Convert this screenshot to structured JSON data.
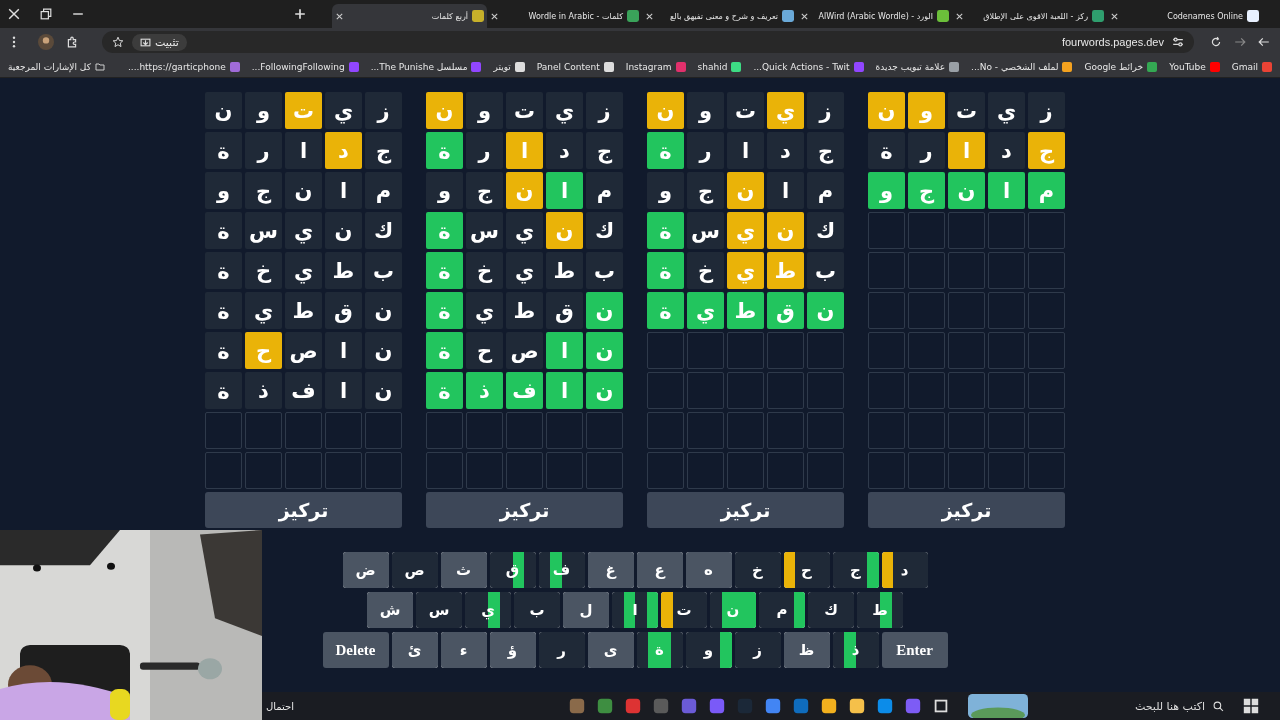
{
  "tabs": [
    {
      "title": "Codenames Online",
      "selected": false
    },
    {
      "title": "ركز - اللعبة الاقوى على الإطلاق",
      "selected": false
    },
    {
      "title": "الورد - AlWird (Arabic Wordle)",
      "selected": false
    },
    {
      "title": "تعريف و شرح و معنى تفيهق بالع",
      "selected": false
    },
    {
      "title": "كلمات - Wordle in Arabic",
      "selected": false
    },
    {
      "title": "أربع كلمات",
      "selected": true
    }
  ],
  "address_bar": {
    "pin_label": "تثبيت",
    "url": "fourwords.pages.dev"
  },
  "bookmarks": {
    "items": [
      "Gmail",
      "YouTube",
      "خرائط Google",
      "لملف الشخصي - No...",
      "علامة تبويب جديدة",
      "Quick Actions - Twit...",
      "shahid",
      "Instagram",
      "Panel Content",
      "تويتر",
      "مسلسل The Punishe...",
      "FollowingFollowing...",
      "https://garticphone...."
    ],
    "all_bookmarks": "كل الإشارات المرجعية"
  },
  "boards": [
    {
      "button": "تركيز",
      "guesses": [
        [
          {
            "letter": "ز",
            "kind": "absent"
          },
          {
            "letter": "ي",
            "kind": "absent"
          },
          {
            "letter": "ت",
            "kind": "absent"
          },
          {
            "letter": "و",
            "kind": "present"
          },
          {
            "letter": "ن",
            "kind": "present"
          }
        ],
        [
          {
            "letter": "ج",
            "kind": "present"
          },
          {
            "letter": "د",
            "kind": "absent"
          },
          {
            "letter": "ا",
            "kind": "present"
          },
          {
            "letter": "ر",
            "kind": "absent"
          },
          {
            "letter": "ة",
            "kind": "absent"
          }
        ],
        [
          {
            "letter": "م",
            "kind": "correct"
          },
          {
            "letter": "ا",
            "kind": "correct"
          },
          {
            "letter": "ن",
            "kind": "correct"
          },
          {
            "letter": "ج",
            "kind": "correct"
          },
          {
            "letter": "و",
            "kind": "correct"
          }
        ]
      ]
    },
    {
      "button": "تركيز",
      "guesses": [
        [
          {
            "letter": "ز",
            "kind": "absent"
          },
          {
            "letter": "ي",
            "kind": "present"
          },
          {
            "letter": "ت",
            "kind": "absent"
          },
          {
            "letter": "و",
            "kind": "absent"
          },
          {
            "letter": "ن",
            "kind": "present"
          }
        ],
        [
          {
            "letter": "ج",
            "kind": "absent"
          },
          {
            "letter": "د",
            "kind": "absent"
          },
          {
            "letter": "ا",
            "kind": "absent"
          },
          {
            "letter": "ر",
            "kind": "absent"
          },
          {
            "letter": "ة",
            "kind": "correct"
          }
        ],
        [
          {
            "letter": "م",
            "kind": "absent"
          },
          {
            "letter": "ا",
            "kind": "absent"
          },
          {
            "letter": "ن",
            "kind": "present"
          },
          {
            "letter": "ج",
            "kind": "absent"
          },
          {
            "letter": "و",
            "kind": "absent"
          }
        ],
        [
          {
            "letter": "ك",
            "kind": "absent"
          },
          {
            "letter": "ن",
            "kind": "present"
          },
          {
            "letter": "ي",
            "kind": "present"
          },
          {
            "letter": "س",
            "kind": "absent"
          },
          {
            "letter": "ة",
            "kind": "correct"
          }
        ],
        [
          {
            "letter": "ب",
            "kind": "absent"
          },
          {
            "letter": "ط",
            "kind": "present"
          },
          {
            "letter": "ي",
            "kind": "present"
          },
          {
            "letter": "خ",
            "kind": "absent"
          },
          {
            "letter": "ة",
            "kind": "correct"
          }
        ],
        [
          {
            "letter": "ن",
            "kind": "correct"
          },
          {
            "letter": "ق",
            "kind": "correct"
          },
          {
            "letter": "ط",
            "kind": "correct"
          },
          {
            "letter": "ي",
            "kind": "correct"
          },
          {
            "letter": "ة",
            "kind": "correct"
          }
        ]
      ]
    },
    {
      "button": "تركيز",
      "guesses": [
        [
          {
            "letter": "ز",
            "kind": "absent"
          },
          {
            "letter": "ي",
            "kind": "absent"
          },
          {
            "letter": "ت",
            "kind": "absent"
          },
          {
            "letter": "و",
            "kind": "absent"
          },
          {
            "letter": "ن",
            "kind": "present"
          }
        ],
        [
          {
            "letter": "ج",
            "kind": "absent"
          },
          {
            "letter": "د",
            "kind": "absent"
          },
          {
            "letter": "ا",
            "kind": "present"
          },
          {
            "letter": "ر",
            "kind": "absent"
          },
          {
            "letter": "ة",
            "kind": "correct"
          }
        ],
        [
          {
            "letter": "م",
            "kind": "absent"
          },
          {
            "letter": "ا",
            "kind": "correct"
          },
          {
            "letter": "ن",
            "kind": "present"
          },
          {
            "letter": "ج",
            "kind": "absent"
          },
          {
            "letter": "و",
            "kind": "absent"
          }
        ],
        [
          {
            "letter": "ك",
            "kind": "absent"
          },
          {
            "letter": "ن",
            "kind": "present"
          },
          {
            "letter": "ي",
            "kind": "absent"
          },
          {
            "letter": "س",
            "kind": "absent"
          },
          {
            "letter": "ة",
            "kind": "correct"
          }
        ],
        [
          {
            "letter": "ب",
            "kind": "absent"
          },
          {
            "letter": "ط",
            "kind": "absent"
          },
          {
            "letter": "ي",
            "kind": "absent"
          },
          {
            "letter": "خ",
            "kind": "absent"
          },
          {
            "letter": "ة",
            "kind": "correct"
          }
        ],
        [
          {
            "letter": "ن",
            "kind": "correct"
          },
          {
            "letter": "ق",
            "kind": "absent"
          },
          {
            "letter": "ط",
            "kind": "absent"
          },
          {
            "letter": "ي",
            "kind": "absent"
          },
          {
            "letter": "ة",
            "kind": "correct"
          }
        ],
        [
          {
            "letter": "ن",
            "kind": "correct"
          },
          {
            "letter": "ا",
            "kind": "correct"
          },
          {
            "letter": "ص",
            "kind": "absent"
          },
          {
            "letter": "ح",
            "kind": "absent"
          },
          {
            "letter": "ة",
            "kind": "correct"
          }
        ],
        [
          {
            "letter": "ن",
            "kind": "correct"
          },
          {
            "letter": "ا",
            "kind": "correct"
          },
          {
            "letter": "ف",
            "kind": "correct"
          },
          {
            "letter": "ذ",
            "kind": "correct"
          },
          {
            "letter": "ة",
            "kind": "correct"
          }
        ]
      ]
    },
    {
      "button": "تركيز",
      "guesses": [
        [
          {
            "letter": "ز",
            "kind": "absent"
          },
          {
            "letter": "ي",
            "kind": "absent"
          },
          {
            "letter": "ت",
            "kind": "present"
          },
          {
            "letter": "و",
            "kind": "absent"
          },
          {
            "letter": "ن",
            "kind": "absent"
          }
        ],
        [
          {
            "letter": "ج",
            "kind": "absent"
          },
          {
            "letter": "د",
            "kind": "present"
          },
          {
            "letter": "ا",
            "kind": "absent"
          },
          {
            "letter": "ر",
            "kind": "absent"
          },
          {
            "letter": "ة",
            "kind": "absent"
          }
        ],
        [
          {
            "letter": "م",
            "kind": "absent"
          },
          {
            "letter": "ا",
            "kind": "absent"
          },
          {
            "letter": "ن",
            "kind": "absent"
          },
          {
            "letter": "ج",
            "kind": "absent"
          },
          {
            "letter": "و",
            "kind": "absent"
          }
        ],
        [
          {
            "letter": "ك",
            "kind": "absent"
          },
          {
            "letter": "ن",
            "kind": "absent"
          },
          {
            "letter": "ي",
            "kind": "absent"
          },
          {
            "letter": "س",
            "kind": "absent"
          },
          {
            "letter": "ة",
            "kind": "absent"
          }
        ],
        [
          {
            "letter": "ب",
            "kind": "absent"
          },
          {
            "letter": "ط",
            "kind": "absent"
          },
          {
            "letter": "ي",
            "kind": "absent"
          },
          {
            "letter": "خ",
            "kind": "absent"
          },
          {
            "letter": "ة",
            "kind": "absent"
          }
        ],
        [
          {
            "letter": "ن",
            "kind": "absent"
          },
          {
            "letter": "ق",
            "kind": "absent"
          },
          {
            "letter": "ط",
            "kind": "absent"
          },
          {
            "letter": "ي",
            "kind": "absent"
          },
          {
            "letter": "ة",
            "kind": "absent"
          }
        ],
        [
          {
            "letter": "ن",
            "kind": "absent"
          },
          {
            "letter": "ا",
            "kind": "absent"
          },
          {
            "letter": "ص",
            "kind": "absent"
          },
          {
            "letter": "ح",
            "kind": "present"
          },
          {
            "letter": "ة",
            "kind": "absent"
          }
        ],
        [
          {
            "letter": "ن",
            "kind": "absent"
          },
          {
            "letter": "ا",
            "kind": "absent"
          },
          {
            "letter": "ف",
            "kind": "absent"
          },
          {
            "letter": "ذ",
            "kind": "absent"
          },
          {
            "letter": "ة",
            "kind": "absent"
          }
        ]
      ]
    }
  ],
  "keyboard": {
    "rows": [
      [
        {
          "label": "د",
          "kind": "letter",
          "boards": [
            {
              "kind": "absent"
            },
            {
              "kind": "absent"
            },
            {
              "kind": "absent"
            },
            {
              "kind": "present"
            }
          ]
        },
        {
          "label": "ج",
          "kind": "letter",
          "boards": [
            {
              "kind": "correct"
            },
            {
              "kind": "absent"
            },
            {
              "kind": "absent"
            },
            {
              "kind": "absent"
            }
          ]
        },
        {
          "label": "ح",
          "kind": "letter",
          "boards": [
            {
              "kind": "absent"
            },
            {
              "kind": "absent"
            },
            {
              "kind": "absent"
            },
            {
              "kind": "present"
            }
          ]
        },
        {
          "label": "خ",
          "kind": "letter",
          "boards": [
            {
              "kind": "absent"
            },
            {
              "kind": "absent"
            },
            {
              "kind": "absent"
            },
            {
              "kind": "absent"
            }
          ]
        },
        {
          "label": "ه",
          "kind": "letter",
          "boards": [
            {
              "kind": "unused"
            },
            {
              "kind": "unused"
            },
            {
              "kind": "unused"
            },
            {
              "kind": "unused"
            }
          ]
        },
        {
          "label": "ع",
          "kind": "letter",
          "boards": [
            {
              "kind": "unused"
            },
            {
              "kind": "unused"
            },
            {
              "kind": "unused"
            },
            {
              "kind": "unused"
            }
          ]
        },
        {
          "label": "غ",
          "kind": "letter",
          "boards": [
            {
              "kind": "unused"
            },
            {
              "kind": "unused"
            },
            {
              "kind": "unused"
            },
            {
              "kind": "unused"
            }
          ]
        },
        {
          "label": "ف",
          "kind": "letter",
          "boards": [
            {
              "kind": "absent"
            },
            {
              "kind": "absent"
            },
            {
              "kind": "correct"
            },
            {
              "kind": "absent"
            }
          ]
        },
        {
          "label": "ق",
          "kind": "letter",
          "boards": [
            {
              "kind": "absent"
            },
            {
              "kind": "correct"
            },
            {
              "kind": "absent"
            },
            {
              "kind": "absent"
            }
          ]
        },
        {
          "label": "ث",
          "kind": "letter",
          "boards": [
            {
              "kind": "unused"
            },
            {
              "kind": "unused"
            },
            {
              "kind": "unused"
            },
            {
              "kind": "unused"
            }
          ]
        },
        {
          "label": "ص",
          "kind": "letter",
          "boards": [
            {
              "kind": "absent"
            },
            {
              "kind": "absent"
            },
            {
              "kind": "absent"
            },
            {
              "kind": "absent"
            }
          ]
        },
        {
          "label": "ض",
          "kind": "letter",
          "boards": [
            {
              "kind": "unused"
            },
            {
              "kind": "unused"
            },
            {
              "kind": "unused"
            },
            {
              "kind": "unused"
            }
          ]
        }
      ],
      [
        {
          "label": "ط",
          "kind": "letter",
          "boards": [
            {
              "kind": "absent"
            },
            {
              "kind": "correct"
            },
            {
              "kind": "absent"
            },
            {
              "kind": "absent"
            }
          ]
        },
        {
          "label": "ك",
          "kind": "letter",
          "boards": [
            {
              "kind": "absent"
            },
            {
              "kind": "absent"
            },
            {
              "kind": "absent"
            },
            {
              "kind": "absent"
            }
          ]
        },
        {
          "label": "م",
          "kind": "letter",
          "boards": [
            {
              "kind": "correct"
            },
            {
              "kind": "absent"
            },
            {
              "kind": "absent"
            },
            {
              "kind": "absent"
            }
          ]
        },
        {
          "label": "ن",
          "kind": "letter",
          "boards": [
            {
              "kind": "correct"
            },
            {
              "kind": "correct"
            },
            {
              "kind": "correct"
            },
            {
              "kind": "absent"
            }
          ]
        },
        {
          "label": "ت",
          "kind": "letter",
          "boards": [
            {
              "kind": "absent"
            },
            {
              "kind": "absent"
            },
            {
              "kind": "absent"
            },
            {
              "kind": "present"
            }
          ]
        },
        {
          "label": "ا",
          "kind": "letter",
          "boards": [
            {
              "kind": "correct"
            },
            {
              "kind": "absent"
            },
            {
              "kind": "correct"
            },
            {
              "kind": "absent"
            }
          ]
        },
        {
          "label": "ل",
          "kind": "letter",
          "boards": [
            {
              "kind": "unused"
            },
            {
              "kind": "unused"
            },
            {
              "kind": "unused"
            },
            {
              "kind": "unused"
            }
          ]
        },
        {
          "label": "ب",
          "kind": "letter",
          "boards": [
            {
              "kind": "absent"
            },
            {
              "kind": "absent"
            },
            {
              "kind": "absent"
            },
            {
              "kind": "absent"
            }
          ]
        },
        {
          "label": "ي",
          "kind": "letter",
          "boards": [
            {
              "kind": "absent"
            },
            {
              "kind": "correct"
            },
            {
              "kind": "absent"
            },
            {
              "kind": "absent"
            }
          ]
        },
        {
          "label": "س",
          "kind": "letter",
          "boards": [
            {
              "kind": "absent"
            },
            {
              "kind": "absent"
            },
            {
              "kind": "absent"
            },
            {
              "kind": "absent"
            }
          ]
        },
        {
          "label": "ش",
          "kind": "letter",
          "boards": [
            {
              "kind": "unused"
            },
            {
              "kind": "unused"
            },
            {
              "kind": "unused"
            },
            {
              "kind": "unused"
            }
          ]
        }
      ],
      [
        {
          "label": "Enter",
          "kind": "action"
        },
        {
          "label": "ذ",
          "kind": "letter",
          "boards": [
            {
              "kind": "absent"
            },
            {
              "kind": "absent"
            },
            {
              "kind": "correct"
            },
            {
              "kind": "absent"
            }
          ]
        },
        {
          "label": "ظ",
          "kind": "letter",
          "boards": [
            {
              "kind": "unused"
            },
            {
              "kind": "unused"
            },
            {
              "kind": "unused"
            },
            {
              "kind": "unused"
            }
          ]
        },
        {
          "label": "ز",
          "kind": "letter",
          "boards": [
            {
              "kind": "absent"
            },
            {
              "kind": "absent"
            },
            {
              "kind": "absent"
            },
            {
              "kind": "absent"
            }
          ]
        },
        {
          "label": "و",
          "kind": "letter",
          "boards": [
            {
              "kind": "correct"
            },
            {
              "kind": "absent"
            },
            {
              "kind": "absent"
            },
            {
              "kind": "absent"
            }
          ]
        },
        {
          "label": "ة",
          "kind": "letter",
          "boards": [
            {
              "kind": "absent"
            },
            {
              "kind": "correct"
            },
            {
              "kind": "correct"
            },
            {
              "kind": "absent"
            }
          ]
        },
        {
          "label": "ى",
          "kind": "letter",
          "boards": [
            {
              "kind": "unused"
            },
            {
              "kind": "unused"
            },
            {
              "kind": "unused"
            },
            {
              "kind": "unused"
            }
          ]
        },
        {
          "label": "ر",
          "kind": "letter",
          "boards": [
            {
              "kind": "absent"
            },
            {
              "kind": "absent"
            },
            {
              "kind": "absent"
            },
            {
              "kind": "absent"
            }
          ]
        },
        {
          "label": "ؤ",
          "kind": "letter",
          "boards": [
            {
              "kind": "unused"
            },
            {
              "kind": "unused"
            },
            {
              "kind": "unused"
            },
            {
              "kind": "unused"
            }
          ]
        },
        {
          "label": "ء",
          "kind": "letter",
          "boards": [
            {
              "kind": "unused"
            },
            {
              "kind": "unused"
            },
            {
              "kind": "unused"
            },
            {
              "kind": "unused"
            }
          ]
        },
        {
          "label": "ئ",
          "kind": "letter",
          "boards": [
            {
              "kind": "unused"
            },
            {
              "kind": "unused"
            },
            {
              "kind": "unused"
            },
            {
              "kind": "unused"
            }
          ]
        },
        {
          "label": "Delete",
          "kind": "action"
        }
      ]
    ]
  },
  "taskbar": {
    "search_placeholder": "اكتب هنا للبحث",
    "window_text": "احتمال"
  }
}
